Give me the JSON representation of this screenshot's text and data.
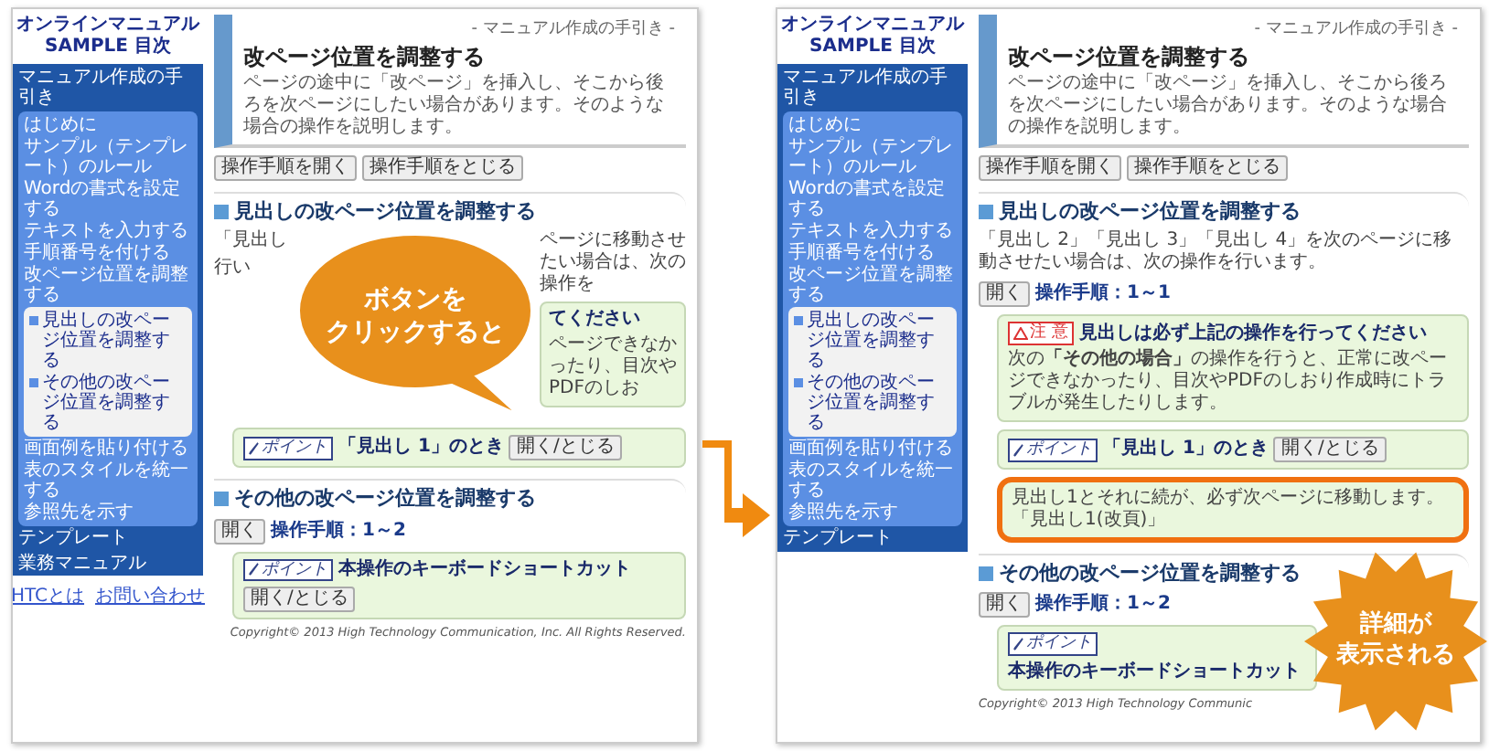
{
  "screens": [
    {
      "sidebar": {
        "title": [
          "オンラインマニュアル",
          "SAMPLE 目次"
        ],
        "section": "マニュアル作成の手引き",
        "items": [
          {
            "label": "はじめに"
          },
          {
            "label": "サンプル（テンプレート）のルール"
          },
          {
            "label": "Wordの書式を設定する"
          },
          {
            "label": "テキストを入力する"
          },
          {
            "label": "手順番号を付ける"
          },
          {
            "label": "改ページ位置を調整する",
            "children": [
              {
                "label": "見出しの改ページ位置を調整する"
              },
              {
                "label": "その他の改ページ位置を調整する"
              }
            ]
          },
          {
            "label": "画面例を貼り付ける"
          },
          {
            "label": "表のスタイルを統一する"
          },
          {
            "label": "参照先を示す"
          }
        ],
        "extra": [
          "テンプレート",
          "業務マニュアル"
        ],
        "links": [
          "HTCとは",
          "お問い合わせ"
        ]
      },
      "page": {
        "breadcrumb": "- マニュアル作成の手引き -",
        "title": "改ページ位置を調整する",
        "description": "ページの途中に「改ページ」を挿入し、そこから後ろを次ページにしたい場合があります。そのような場合の操作を説明します。",
        "buttons": [
          "操作手順を開く",
          "操作手順をとじる"
        ],
        "sections": [
          {
            "heading": "見出しの改ページ位置を調整する",
            "intro": [
              "「見出し",
              "行い",
              "ページに移動させたい場合は、次の操作を"
            ],
            "boxes": [
              {
                "kind": "caution",
                "title": "てください",
                "body": "ページできなかったり、目次やPDFのしお"
              },
              {
                "kind": "point",
                "badge": "ポイント",
                "title": "「見出し 1」のとき",
                "button": "開く/とじる"
              }
            ]
          },
          {
            "heading": "その他の改ページ位置を調整する",
            "open_button": "開く",
            "steps": "操作手順：1～2",
            "boxes": [
              {
                "kind": "point",
                "badge": "ポイント",
                "title": "本操作のキーボードショートカット",
                "button": "開く/とじる"
              }
            ]
          }
        ],
        "copyright": "Copyright© 2013 High Technology Communication, Inc. All Rights Reserved."
      }
    },
    {
      "sidebar": {
        "title": [
          "オンラインマニュアル",
          "SAMPLE 目次"
        ],
        "section": "マニュアル作成の手引き",
        "items": [
          {
            "label": "はじめに"
          },
          {
            "label": "サンプル（テンプレート）のルール"
          },
          {
            "label": "Wordの書式を設定する"
          },
          {
            "label": "テキストを入力する"
          },
          {
            "label": "手順番号を付ける"
          },
          {
            "label": "改ページ位置を調整する",
            "children": [
              {
                "label": "見出しの改ページ位置を調整する"
              },
              {
                "label": "その他の改ページ位置を調整する"
              }
            ]
          },
          {
            "label": "画面例を貼り付ける"
          },
          {
            "label": "表のスタイルを統一する"
          },
          {
            "label": "参照先を示す"
          }
        ],
        "extra": [
          "テンプレート"
        ]
      },
      "page": {
        "breadcrumb": "- マニュアル作成の手引き -",
        "title": "改ページ位置を調整する",
        "description": "ページの途中に「改ページ」を挿入し、そこから後ろを次ページにしたい場合があります。そのような場合の操作を説明します。",
        "buttons": [
          "操作手順を開く",
          "操作手順をとじる"
        ],
        "sections": [
          {
            "heading": "見出しの改ページ位置を調整する",
            "intro": [
              "「見出し 2」「見出し 3」「見出し 4」を次のページに移動させたい場合は、次の操作を行います。"
            ],
            "open_button": "開く",
            "steps": "操作手順：1～1",
            "boxes": [
              {
                "kind": "caution",
                "badge": "注 意",
                "title": "見出しは必ず上記の操作を行ってください",
                "body": "次の**「その他の場合」**の操作を行うと、正常に改ページできなかったり、目次やPDFのしおり作成時にトラブルが発生したりします。"
              },
              {
                "kind": "point",
                "badge": "ポイント",
                "title": "「見出し 1」のとき",
                "button": "開く/とじる",
                "detail": {
                  "text": "見出し1とそれに続が、必ず次ページに移動します。「見出し1(改頁)」",
                  "highlighted": true
                }
              }
            ]
          },
          {
            "heading": "その他の改ページ位置を調整する",
            "open_button": "開く",
            "steps": "操作手順：1～2",
            "boxes": [
              {
                "kind": "point",
                "badge": "ポイント",
                "title": "本操作のキーボードショートカット"
              }
            ]
          }
        ],
        "copyright": "Copyright© 2013 High Technology Communic"
      }
    }
  ],
  "callouts": [
    {
      "kind": "bubble",
      "lines": [
        "ボタンを",
        "クリックすると"
      ]
    },
    {
      "kind": "starburst",
      "lines": [
        "詳細が",
        "表示される"
      ]
    }
  ]
}
